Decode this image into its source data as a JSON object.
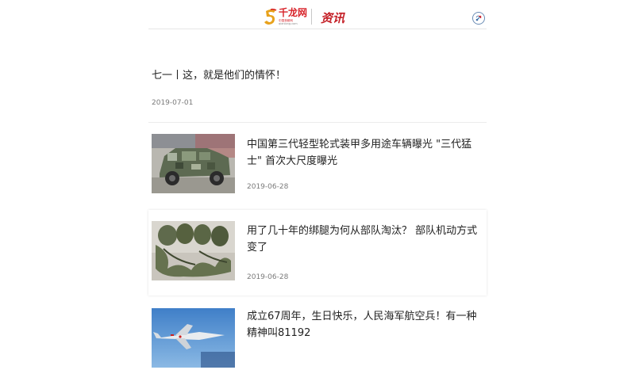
{
  "header": {
    "logo_name": "千龙网",
    "logo_tagline": "中国首都网",
    "logo_url": "qianlong.com",
    "section_title": "资讯",
    "share_icon": "share-icon"
  },
  "text_article": {
    "title": "七一丨这，就是他们的情怀！",
    "date": "2019-07-01"
  },
  "articles": [
    {
      "title": "中国第三代轻型轮式装甲多用途车辆曝光 \"三代猛士\" 首次大尺度曝光",
      "date": "2019-06-28",
      "thumb": "armored-vehicle-photo"
    },
    {
      "title": "用了几十年的绑腿为何从部队淘汰？ 部队机动方式变了",
      "date": "2019-06-28",
      "thumb": "leg-wraps-photo"
    },
    {
      "title": "成立67周年，生日快乐，人民海军航空兵！有一种精神叫81192",
      "date": "",
      "thumb": "fighter-jet-photo"
    }
  ],
  "colors": {
    "brand_red": "#c41f26",
    "text": "#222222",
    "meta": "#7a7a7a",
    "divider": "#e6e6e6"
  }
}
